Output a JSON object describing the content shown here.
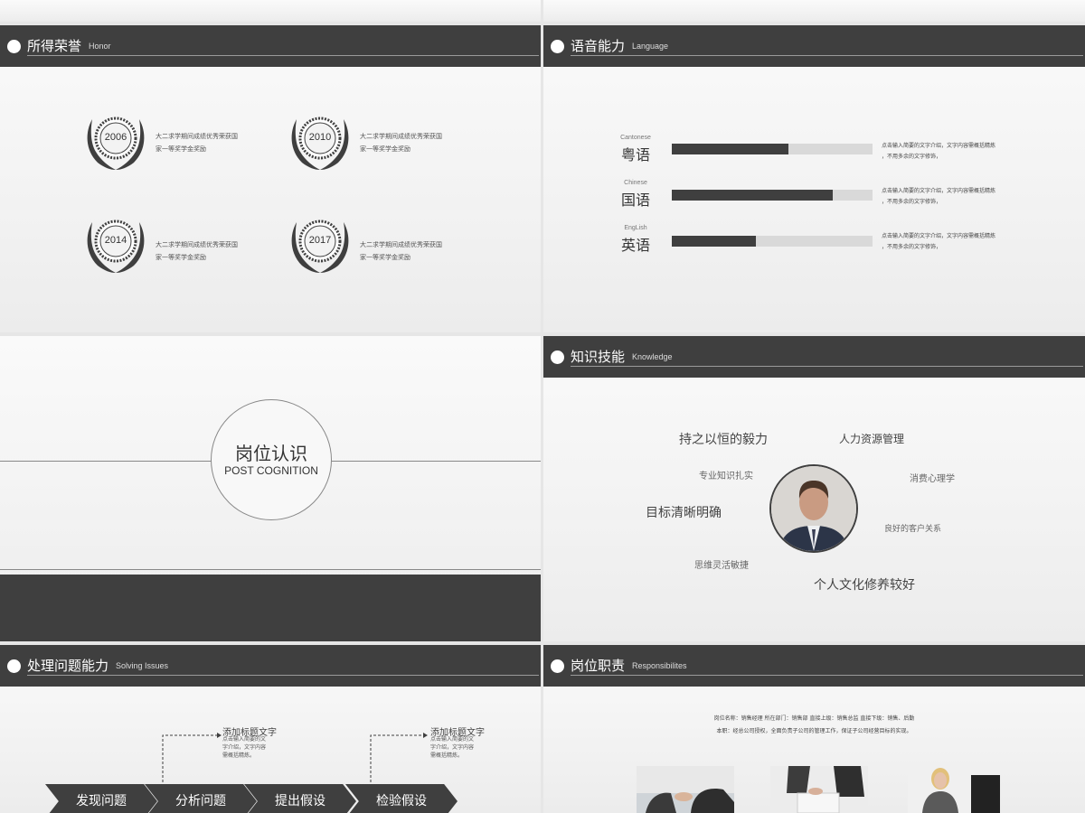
{
  "honor": {
    "title": "所得荣誉",
    "subtitle": "Honor",
    "items": [
      {
        "year": "2006",
        "line1": "大二求学期间成绩优秀荣获国",
        "line2": "家一等奖学金奖励"
      },
      {
        "year": "2010",
        "line1": "大二求学期间成绩优秀荣获国",
        "line2": "家一等奖学金奖励"
      },
      {
        "year": "2014",
        "line1": "大二求学期间成绩优秀荣获国",
        "line2": "家一等奖学金奖励"
      },
      {
        "year": "2017",
        "line1": "大二求学期间成绩优秀荣获国",
        "line2": "家一等奖学金奖励"
      }
    ]
  },
  "language": {
    "title": "语音能力",
    "subtitle": "Language",
    "items": [
      {
        "en": "Cantonese",
        "cn": "粤语",
        "level": 0.58,
        "desc1": "点击输入简要的文字介绍，文字内容需概括精炼",
        "desc2": "，不用多余的文字修饰，"
      },
      {
        "en": "Chinese",
        "cn": "国语",
        "level": 0.8,
        "desc1": "点击输入简要的文字介绍，文字内容需概括精炼",
        "desc2": "，不用多余的文字修饰，"
      },
      {
        "en": "EngLish",
        "cn": "英语",
        "level": 0.42,
        "desc1": "点击输入简要的文字介绍，文字内容需概括精炼",
        "desc2": "，不用多余的文字修饰，"
      }
    ]
  },
  "cognition": {
    "title": "岗位认识",
    "subtitle": "POST COGNITION"
  },
  "knowledge": {
    "title": "知识技能",
    "subtitle": "Knowledge",
    "keywords": {
      "k1": "持之以恒的毅力",
      "k2": "人力资源管理",
      "k3": "专业知识扎实",
      "k4": "消费心理学",
      "k5": "目标清晰明确",
      "k6": "良好的客户关系",
      "k7": "思维灵活敏捷",
      "k8": "个人文化修养较好"
    }
  },
  "solving": {
    "title": "处理问题能力",
    "subtitle": "Solving Issues",
    "note1": {
      "title": "添加标题文字",
      "l1": "点击输入简要的文",
      "l2": "字介绍，文字内容",
      "l3": "需概括精炼。"
    },
    "note2": {
      "title": "添加标题文字",
      "l1": "点击输入简要的文",
      "l2": "字介绍，文字内容",
      "l3": "需概括精炼。"
    },
    "steps": [
      "发现问题",
      "分析问题",
      "提出假设",
      "检验假设"
    ]
  },
  "responsibilities": {
    "title": "岗位职责",
    "subtitle": "Responsibilites",
    "line1": "岗位名称：销售经理  所在部门：销售部  直接上级：销售总监  直接下级：销售、后勤",
    "line2": "本职：经总公司授权，全面负责子公司的管理工作，保证子公司经营目标的实现。"
  },
  "colors": {
    "dark": "#3f3f3f",
    "bar_bg": "#d9d9d9"
  }
}
